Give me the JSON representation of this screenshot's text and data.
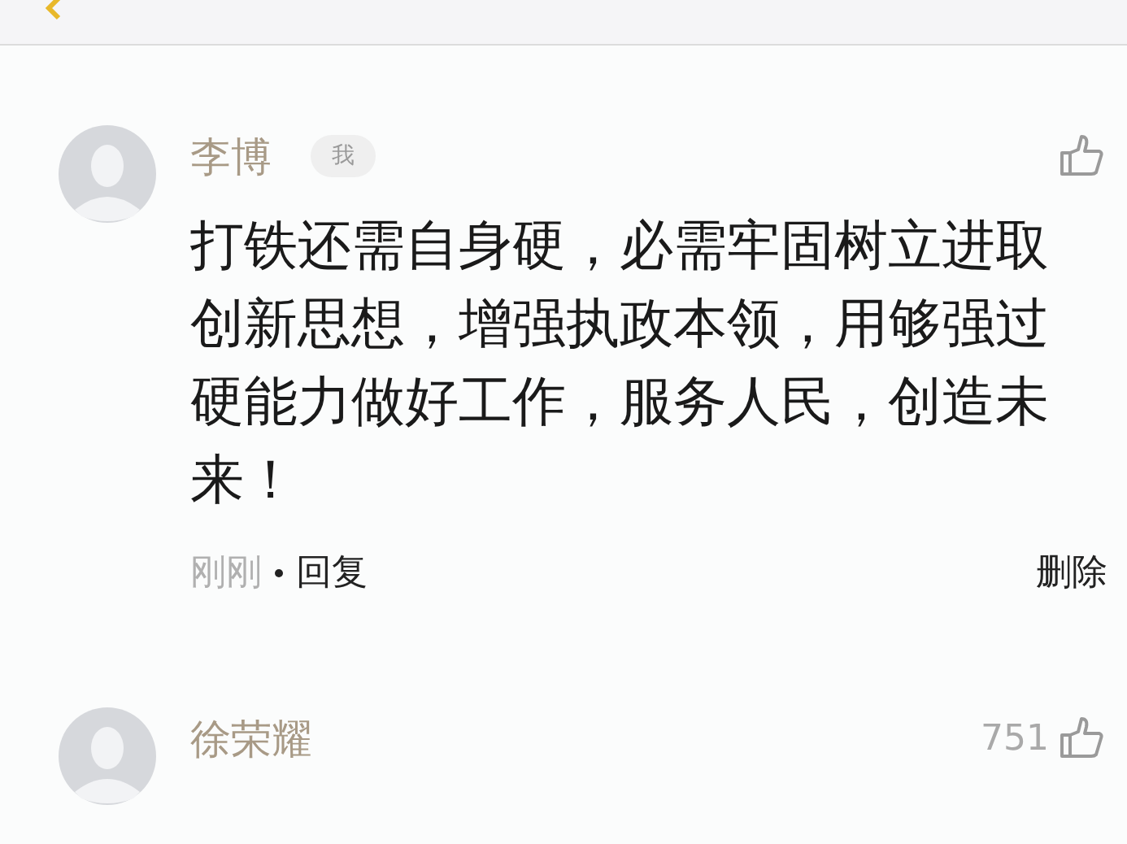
{
  "comments": [
    {
      "name": "李博",
      "me_label": "我",
      "text": "打铁还需自身硬，必需牢固树立进取创新思想，增强执政本领，用够强过硬能力做好工作，服务人民，创造未来！",
      "time": "刚刚",
      "reply": "回复",
      "delete": "删除"
    },
    {
      "name": "徐荣耀",
      "likes": "751"
    }
  ]
}
